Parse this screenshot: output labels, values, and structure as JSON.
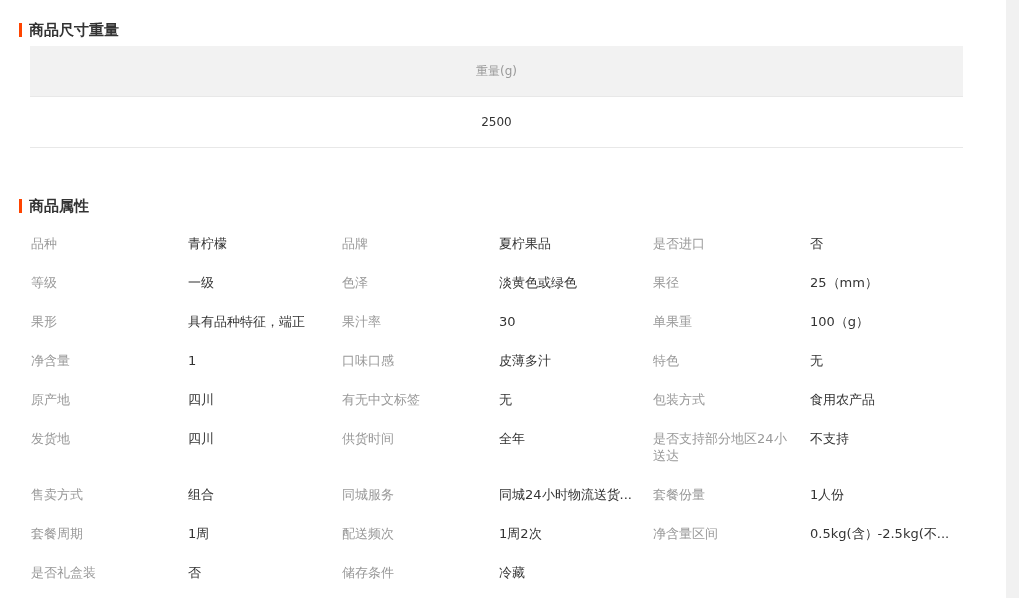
{
  "size_section": {
    "title": "商品尺寸重量",
    "columns": [
      "重量(g)"
    ],
    "rows": [
      [
        "2500"
      ]
    ]
  },
  "attributes_section": {
    "title": "商品属性",
    "items": [
      {
        "label": "品种",
        "value": "青柠檬"
      },
      {
        "label": "品牌",
        "value": "夏柠果品"
      },
      {
        "label": "是否进口",
        "value": "否"
      },
      {
        "label": "等级",
        "value": "一级"
      },
      {
        "label": "色泽",
        "value": "淡黄色或绿色"
      },
      {
        "label": "果径",
        "value": "25（mm）"
      },
      {
        "label": "果形",
        "value": "具有品种特征，端正"
      },
      {
        "label": "果汁率",
        "value": "30"
      },
      {
        "label": "单果重",
        "value": "100（g）"
      },
      {
        "label": "净含量",
        "value": "1"
      },
      {
        "label": "口味口感",
        "value": "皮薄多汁"
      },
      {
        "label": "特色",
        "value": "无"
      },
      {
        "label": "原产地",
        "value": "四川"
      },
      {
        "label": "有无中文标签",
        "value": "无"
      },
      {
        "label": "包装方式",
        "value": "食用农产品"
      },
      {
        "label": "发货地",
        "value": "四川"
      },
      {
        "label": "供货时间",
        "value": "全年"
      },
      {
        "label": "是否支持部分地区24小送达",
        "value": "不支持"
      },
      {
        "label": "售卖方式",
        "value": "组合"
      },
      {
        "label": "同城服务",
        "value": "同城24小时物流送货..."
      },
      {
        "label": "套餐份量",
        "value": "1人份"
      },
      {
        "label": "套餐周期",
        "value": "1周"
      },
      {
        "label": "配送频次",
        "value": "1周2次"
      },
      {
        "label": "净含量区间",
        "value": "0.5kg(含）-2.5kg(不..."
      },
      {
        "label": "是否礼盒装",
        "value": "否"
      },
      {
        "label": "储存条件",
        "value": "冷藏"
      }
    ]
  }
}
